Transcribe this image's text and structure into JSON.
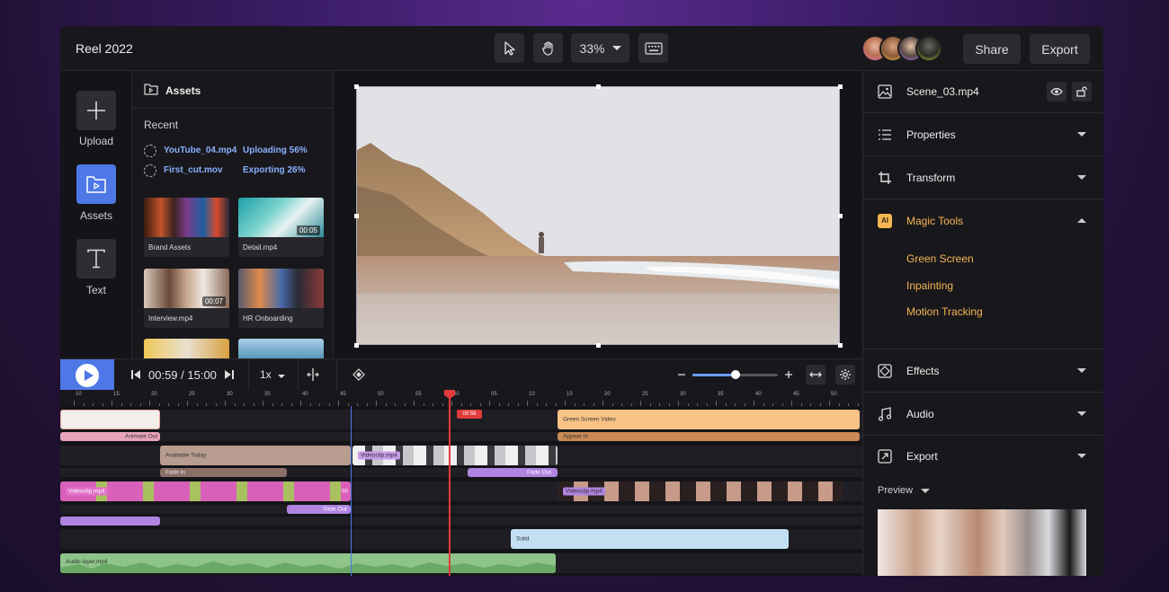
{
  "project": {
    "title": "Reel 2022"
  },
  "toolbar": {
    "zoom": "33%",
    "share_label": "Share",
    "export_label": "Export"
  },
  "rail": {
    "upload_label": "Upload",
    "assets_label": "Assets",
    "text_label": "Text"
  },
  "assets": {
    "title": "Assets",
    "recent_label": "Recent",
    "uploads": [
      {
        "name": "YouTube_04.mp4",
        "status": "Uploading 56%"
      },
      {
        "name": "First_cut.mov",
        "status": "Exporting 26%"
      }
    ],
    "items": [
      {
        "label": "Brand Assets",
        "duration": ""
      },
      {
        "label": "Detail.mp4",
        "duration": "00:05"
      },
      {
        "label": "Interview.mp4",
        "duration": "00:07"
      },
      {
        "label": "HR Onboarding",
        "duration": ""
      }
    ]
  },
  "inspector": {
    "filename": "Scene_03.mp4",
    "sections": {
      "properties": "Properties",
      "transform": "Transform",
      "magic_tools": "Magic Tools",
      "effects": "Effects",
      "audio": "Audio",
      "export": "Export"
    },
    "magic_badge": "AI",
    "magic_items": [
      "Green Screen",
      "Inpainting",
      "Motion Tracking"
    ],
    "preview_label": "Preview"
  },
  "timeline": {
    "timecode": "00:59 / 15:00",
    "speed": "1x",
    "playhead_label": "00:59",
    "ruler_ticks": [
      "10",
      "15",
      "20",
      "25",
      "30",
      "35",
      "40",
      "45",
      "50",
      "55",
      "00",
      "05",
      "10",
      "15",
      "20",
      "25",
      "30",
      "35",
      "40",
      "45",
      "50"
    ],
    "clips": {
      "green_screen": "Green Screen Video",
      "appear_in": "Appear In",
      "animate_out": "Animate Out",
      "available_today": "Available Today",
      "fade_in": "Fade In",
      "videoclip_a": "Videoclip.mp4",
      "fade_out": "Fade Out",
      "videoclip_b": "Videoclip.mp4",
      "videoclip_c": "Videoclip.mp4",
      "slide_out": "Slide Out",
      "solid": "Solid",
      "audio_layer": "Audio layer.mp4",
      "clip_end": "00"
    }
  },
  "colors": {
    "accent": "#4e78e6",
    "magic": "#f5b553",
    "playhead": "#e23b3b",
    "link": "#8ab0ff"
  }
}
